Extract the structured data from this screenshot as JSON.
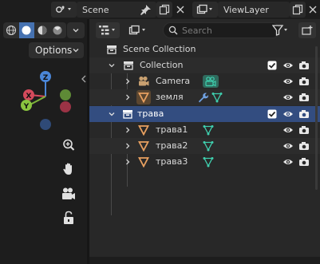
{
  "topbar": {
    "scene_icon": "scene-icon",
    "scene_name": "Scene",
    "view_layer_icon": "view-layer-icon",
    "view_layer_name": "ViewLayer"
  },
  "viewport": {
    "shading_modes": [
      "wireframe",
      "solid",
      "material-preview",
      "rendered"
    ],
    "active_shading": "solid",
    "options_label": "Options",
    "gizmo_axes": [
      "Z",
      "X",
      "Y"
    ],
    "nav_tools": [
      "zoom-icon",
      "hand-icon",
      "camera-view-icon",
      "lock-icon"
    ]
  },
  "outliner": {
    "search_placeholder": "Search",
    "rows": [
      {
        "label": "Scene Collection",
        "type": "scene-collection"
      },
      {
        "label": "Collection",
        "type": "collection",
        "checked": true
      },
      {
        "label": "Camera",
        "type": "camera"
      },
      {
        "label": "земля",
        "type": "mesh"
      },
      {
        "label": "трава",
        "type": "collection",
        "checked": true,
        "selected": true
      },
      {
        "label": "трава1",
        "type": "mesh"
      },
      {
        "label": "трава2",
        "type": "mesh"
      },
      {
        "label": "трава3",
        "type": "mesh"
      }
    ]
  },
  "colors": {
    "accent": "#4672b1",
    "selected_row": "#334d80",
    "camera": "#c8a070",
    "mesh": "#e8a060",
    "data_green": "#3fcfae"
  }
}
